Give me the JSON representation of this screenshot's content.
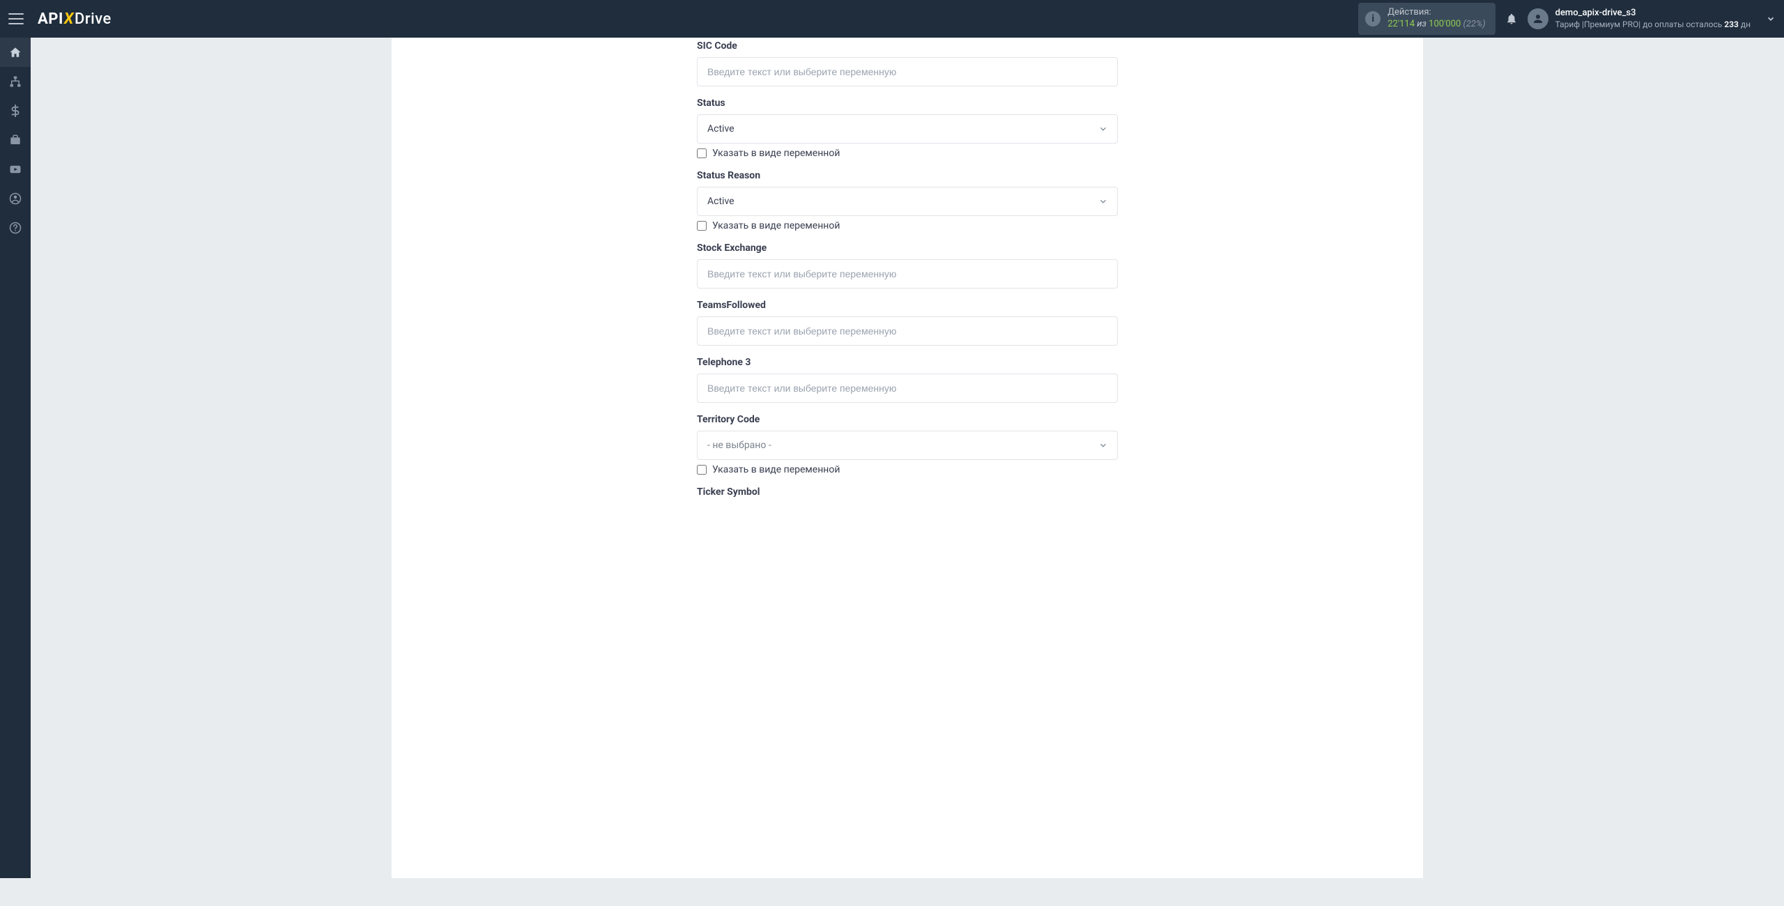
{
  "header": {
    "logo": {
      "api": "API",
      "x": "X",
      "drive": "Drive"
    },
    "actions": {
      "label": "Действия:",
      "count": "22'114",
      "of": "из",
      "limit": "100'000",
      "pct": "(22%)"
    },
    "user": {
      "name": "demo_apix-drive_s3",
      "tariff_prefix": "Тариф |",
      "tariff_name": "Премиум PRO",
      "pay_prefix": "| до оплаты осталось ",
      "days": "233",
      "days_suffix": " дн"
    }
  },
  "sidebar": {
    "items": [
      {
        "key": "home",
        "icon": "home-icon"
      },
      {
        "key": "connections",
        "icon": "sitemap-icon"
      },
      {
        "key": "billing",
        "icon": "dollar-icon"
      },
      {
        "key": "tools",
        "icon": "briefcase-icon"
      },
      {
        "key": "video",
        "icon": "youtube-icon"
      },
      {
        "key": "account",
        "icon": "user-circle-icon"
      },
      {
        "key": "help",
        "icon": "question-circle-icon"
      }
    ]
  },
  "form": {
    "placeholder_text": "Введите текст или выберите переменную",
    "checkbox_label": "Указать в виде переменной",
    "not_selected": "- не выбрано -",
    "fields": [
      {
        "label": "SIC Code",
        "type": "text"
      },
      {
        "label": "Status",
        "type": "select",
        "value": "Active",
        "checkbox": true
      },
      {
        "label": "Status Reason",
        "type": "select",
        "value": "Active",
        "checkbox": true
      },
      {
        "label": "Stock Exchange",
        "type": "text"
      },
      {
        "label": "TeamsFollowed",
        "type": "text"
      },
      {
        "label": "Telephone 3",
        "type": "text"
      },
      {
        "label": "Territory Code",
        "type": "select",
        "value_key": "not_selected",
        "muted": true,
        "checkbox": true
      },
      {
        "label": "Ticker Symbol",
        "type": "text",
        "no_input": true
      }
    ]
  }
}
